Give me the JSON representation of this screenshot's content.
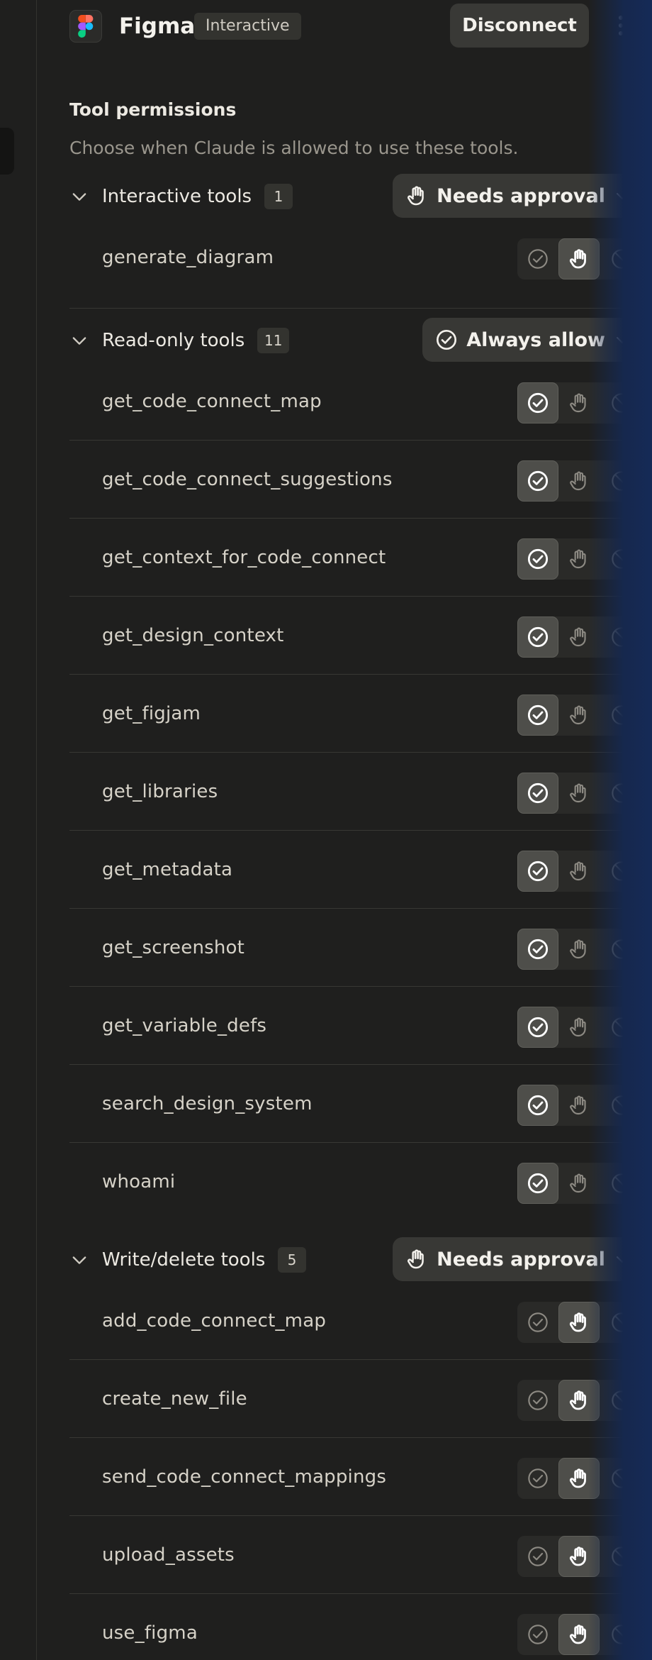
{
  "app": {
    "title": "Figma",
    "badge": "Interactive",
    "disconnect_label": "Disconnect",
    "more_icon": "more-vertical-icon"
  },
  "permissions": {
    "title": "Tool permissions",
    "subtitle": "Choose when Claude is allowed to use these tools."
  },
  "groups": [
    {
      "label": "Interactive tools",
      "count": "1",
      "policy": "Needs approval",
      "policy_icon": "hand-icon",
      "tools": [
        {
          "name": "generate_diagram",
          "mode": "approval"
        }
      ]
    },
    {
      "label": "Read-only tools",
      "count": "11",
      "policy": "Always allow",
      "policy_icon": "check-circle-icon",
      "tools": [
        {
          "name": "get_code_connect_map",
          "mode": "allow"
        },
        {
          "name": "get_code_connect_suggestions",
          "mode": "allow"
        },
        {
          "name": "get_context_for_code_connect",
          "mode": "allow"
        },
        {
          "name": "get_design_context",
          "mode": "allow"
        },
        {
          "name": "get_figjam",
          "mode": "allow"
        },
        {
          "name": "get_libraries",
          "mode": "allow"
        },
        {
          "name": "get_metadata",
          "mode": "allow"
        },
        {
          "name": "get_screenshot",
          "mode": "allow"
        },
        {
          "name": "get_variable_defs",
          "mode": "allow"
        },
        {
          "name": "search_design_system",
          "mode": "allow"
        },
        {
          "name": "whoami",
          "mode": "allow"
        }
      ]
    },
    {
      "label": "Write/delete tools",
      "count": "5",
      "policy": "Needs approval",
      "policy_icon": "hand-icon",
      "tools": [
        {
          "name": "add_code_connect_map",
          "mode": "approval"
        },
        {
          "name": "create_new_file",
          "mode": "approval"
        },
        {
          "name": "send_code_connect_mappings",
          "mode": "approval"
        },
        {
          "name": "upload_assets",
          "mode": "approval"
        },
        {
          "name": "use_figma",
          "mode": "approval"
        }
      ]
    }
  ],
  "colors": {
    "background": "#1f1f1e",
    "active_segment": "#4e4e4a",
    "policy_button": "#383835"
  }
}
